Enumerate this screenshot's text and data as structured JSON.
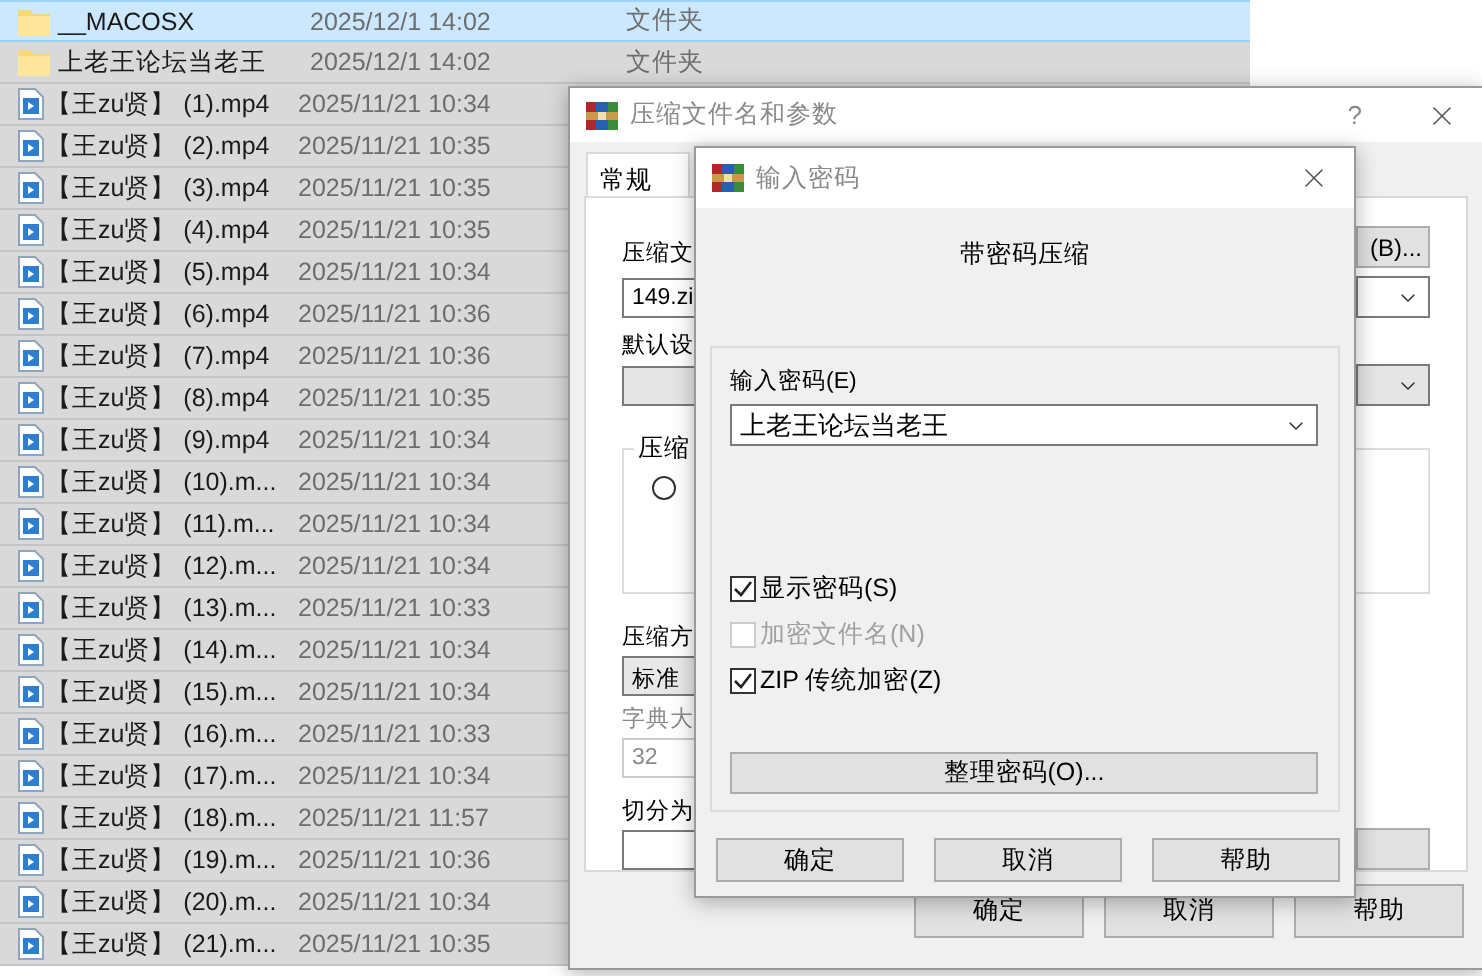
{
  "file_list": [
    {
      "kind": "folder",
      "name": "__MACOSX",
      "date": "2025/12/1 14:02",
      "type": "文件夹",
      "selected": true
    },
    {
      "kind": "folder",
      "name": "上老王论坛当老王",
      "date": "2025/12/1 14:02",
      "type": "文件夹",
      "selected": false
    },
    {
      "kind": "video",
      "name": "【王zu贤】 (1).mp4",
      "date": "2025/11/21 10:34",
      "selected": false
    },
    {
      "kind": "video",
      "name": "【王zu贤】 (2).mp4",
      "date": "2025/11/21 10:35",
      "selected": false
    },
    {
      "kind": "video",
      "name": "【王zu贤】 (3).mp4",
      "date": "2025/11/21 10:35",
      "selected": false
    },
    {
      "kind": "video",
      "name": "【王zu贤】 (4).mp4",
      "date": "2025/11/21 10:35",
      "selected": false
    },
    {
      "kind": "video",
      "name": "【王zu贤】 (5).mp4",
      "date": "2025/11/21 10:34",
      "selected": false
    },
    {
      "kind": "video",
      "name": "【王zu贤】 (6).mp4",
      "date": "2025/11/21 10:36",
      "selected": false
    },
    {
      "kind": "video",
      "name": "【王zu贤】 (7).mp4",
      "date": "2025/11/21 10:36",
      "selected": false
    },
    {
      "kind": "video",
      "name": "【王zu贤】 (8).mp4",
      "date": "2025/11/21 10:35",
      "selected": false
    },
    {
      "kind": "video",
      "name": "【王zu贤】 (9).mp4",
      "date": "2025/11/21 10:34",
      "selected": false
    },
    {
      "kind": "video",
      "name": "【王zu贤】 (10).m...",
      "date": "2025/11/21 10:34",
      "selected": false
    },
    {
      "kind": "video",
      "name": "【王zu贤】 (11).m...",
      "date": "2025/11/21 10:34",
      "selected": false
    },
    {
      "kind": "video",
      "name": "【王zu贤】 (12).m...",
      "date": "2025/11/21 10:34",
      "selected": false
    },
    {
      "kind": "video",
      "name": "【王zu贤】 (13).m...",
      "date": "2025/11/21 10:33",
      "selected": false
    },
    {
      "kind": "video",
      "name": "【王zu贤】 (14).m...",
      "date": "2025/11/21 10:34",
      "selected": false
    },
    {
      "kind": "video",
      "name": "【王zu贤】 (15).m...",
      "date": "2025/11/21 10:34",
      "selected": false
    },
    {
      "kind": "video",
      "name": "【王zu贤】 (16).m...",
      "date": "2025/11/21 10:33",
      "selected": false
    },
    {
      "kind": "video",
      "name": "【王zu贤】 (17).m...",
      "date": "2025/11/21 10:34",
      "selected": false
    },
    {
      "kind": "video",
      "name": "【王zu贤】 (18).m...",
      "date": "2025/11/21 11:57",
      "selected": false
    },
    {
      "kind": "video",
      "name": "【王zu贤】 (19).m...",
      "date": "2025/11/21 10:36",
      "selected": false
    },
    {
      "kind": "video",
      "name": "【王zu贤】 (20).m...",
      "date": "2025/11/21 10:34",
      "selected": false
    },
    {
      "kind": "video",
      "name": "【王zu贤】 (21).m...",
      "date": "2025/11/21 10:35",
      "selected": false
    }
  ],
  "archive_dialog": {
    "title": "压缩文件名和参数",
    "help": "?",
    "tabs": [
      {
        "label": "常规",
        "selected": true
      }
    ],
    "archive_name_label": "压缩文",
    "browse_button": "(B)...",
    "archive_name": "149.zi",
    "profile_label": "默认设",
    "format_group_label": "压缩",
    "format_radio": {
      "selected": false
    },
    "method_label": "压缩方",
    "method": "标准",
    "dictionary_label": "字典大",
    "dictionary": "32",
    "dictionary_disabled": true,
    "split_label": "切分为",
    "buttons": [
      "确定",
      "取消",
      "帮助"
    ]
  },
  "password_dialog": {
    "title": "输入密码",
    "heading": "带密码压缩",
    "password_label": "输入密码(E)",
    "password": "上老王论坛当老王",
    "options": [
      {
        "label": "显示密码(S)",
        "checked": true,
        "disabled": false
      },
      {
        "label": "加密文件名(N)",
        "checked": false,
        "disabled": true
      },
      {
        "label": "ZIP 传统加密(Z)",
        "checked": true,
        "disabled": false
      }
    ],
    "manage_button": "整理密码(O)...",
    "buttons": [
      "确定",
      "取消",
      "帮助"
    ]
  }
}
